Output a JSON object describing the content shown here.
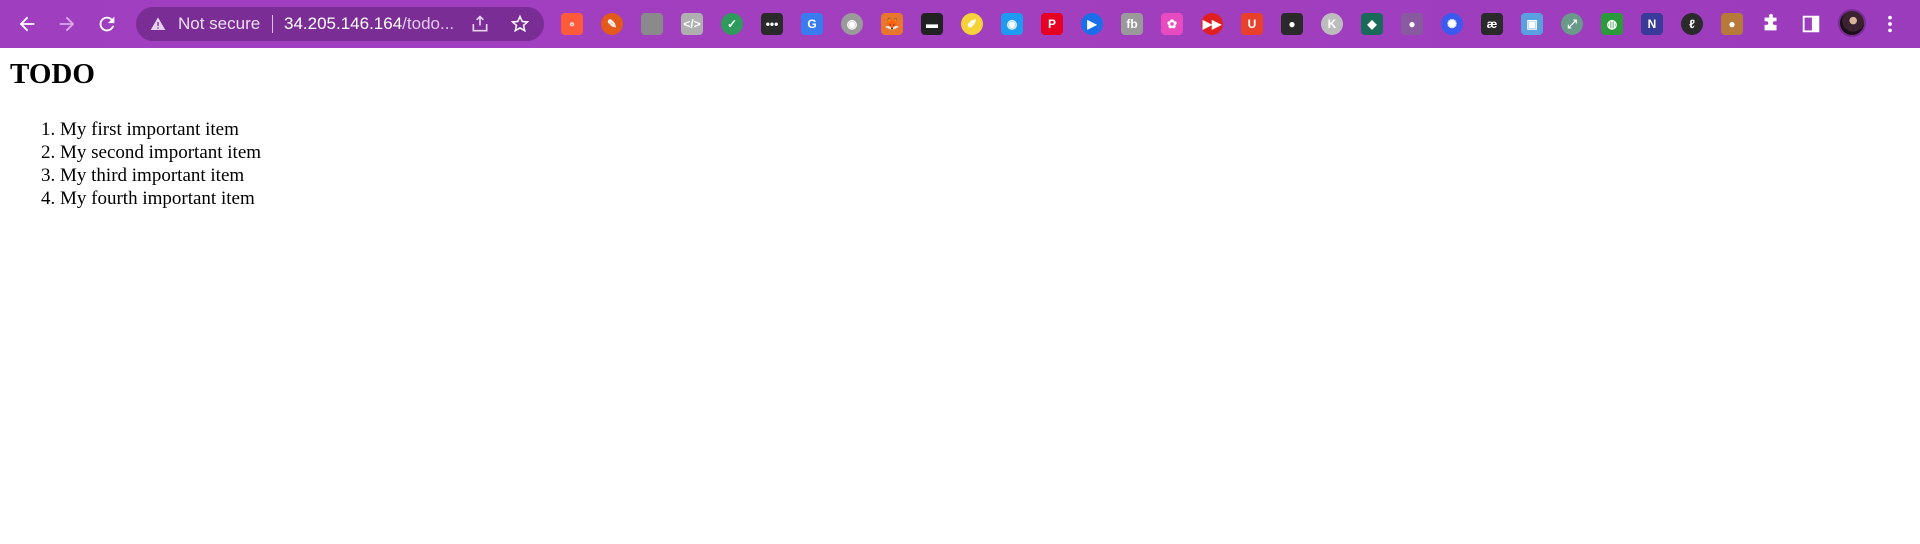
{
  "browser": {
    "omnibox": {
      "security_label": "Not secure",
      "url_host": "34.205.146.164",
      "url_path": "/todo..."
    },
    "extensions": [
      {
        "icon": "green-dots-ext-icon",
        "color": "#ff5a3a",
        "glyph": "∘"
      },
      {
        "icon": "paintbrush-ext-icon",
        "color": "#e45a1a",
        "glyph": "✎"
      },
      {
        "icon": "gray-circle-ext-icon",
        "color": "#8a8a8a",
        "glyph": ""
      },
      {
        "icon": "code-ext-icon",
        "color": "#b0b0b0",
        "glyph": "</>"
      },
      {
        "icon": "mail-check-ext-icon",
        "color": "#2e9a5c",
        "glyph": "✓"
      },
      {
        "icon": "dots-ext-icon",
        "color": "#2a2a2a",
        "glyph": "•••"
      },
      {
        "icon": "google-translate-ext-icon",
        "color": "#3b7bf0",
        "glyph": "G"
      },
      {
        "icon": "camera-ext-icon",
        "color": "#9a9a9a",
        "glyph": "◉"
      },
      {
        "icon": "fox-ext-icon",
        "color": "#e8762c",
        "glyph": "🦊"
      },
      {
        "icon": "incognito-ext-icon",
        "color": "#222222",
        "glyph": "▬"
      },
      {
        "icon": "notes-ext-icon",
        "color": "#f5d23a",
        "glyph": "✐"
      },
      {
        "icon": "eye-ext-icon",
        "color": "#1e9bf0",
        "glyph": "◉"
      },
      {
        "icon": "pinterest-ext-icon",
        "color": "#e60023",
        "glyph": "P"
      },
      {
        "icon": "play-ext-icon",
        "color": "#1a6fe8",
        "glyph": "▶"
      },
      {
        "icon": "fb-ext-icon",
        "color": "#9a9a9a",
        "glyph": "fb"
      },
      {
        "icon": "color-wheel-ext-icon",
        "color": "#e84ac0",
        "glyph": "✿"
      },
      {
        "icon": "youtube-ext-icon",
        "color": "#e02020",
        "glyph": "▶▶"
      },
      {
        "icon": "u-ext-icon",
        "color": "#e8402a",
        "glyph": "U"
      },
      {
        "icon": "orange-blob-ext-icon",
        "color": "#2a2a2a",
        "glyph": "●"
      },
      {
        "icon": "k-ext-icon",
        "color": "#bdbdbd",
        "glyph": "K"
      },
      {
        "icon": "teal-diamond-ext-icon",
        "color": "#1a6a5a",
        "glyph": "◆"
      },
      {
        "icon": "chat-bubble-ext-icon",
        "color": "#8a5aa0",
        "glyph": "●"
      },
      {
        "icon": "blue-gear-ext-icon",
        "color": "#3a5af0",
        "glyph": "✺"
      },
      {
        "icon": "ae-ext-icon",
        "color": "#2a2a2a",
        "glyph": "æ"
      },
      {
        "icon": "image-ext-icon",
        "color": "#5aa0e0",
        "glyph": "▣"
      },
      {
        "icon": "expand-ext-icon",
        "color": "#6a9a8a",
        "glyph": "⤢"
      },
      {
        "icon": "globe-ext-icon",
        "color": "#2a9a3a",
        "glyph": "◍"
      },
      {
        "icon": "n-ext-icon",
        "color": "#3a3a9a",
        "glyph": "N"
      },
      {
        "icon": "feather-ext-icon",
        "color": "#2a2a2a",
        "glyph": "ℓ"
      },
      {
        "icon": "cookie-ext-icon",
        "color": "#b87a3a",
        "glyph": "●"
      }
    ]
  },
  "page": {
    "title": "TODO",
    "items": [
      "My first important item",
      "My second important item",
      "My third important item",
      "My fourth important item"
    ]
  }
}
